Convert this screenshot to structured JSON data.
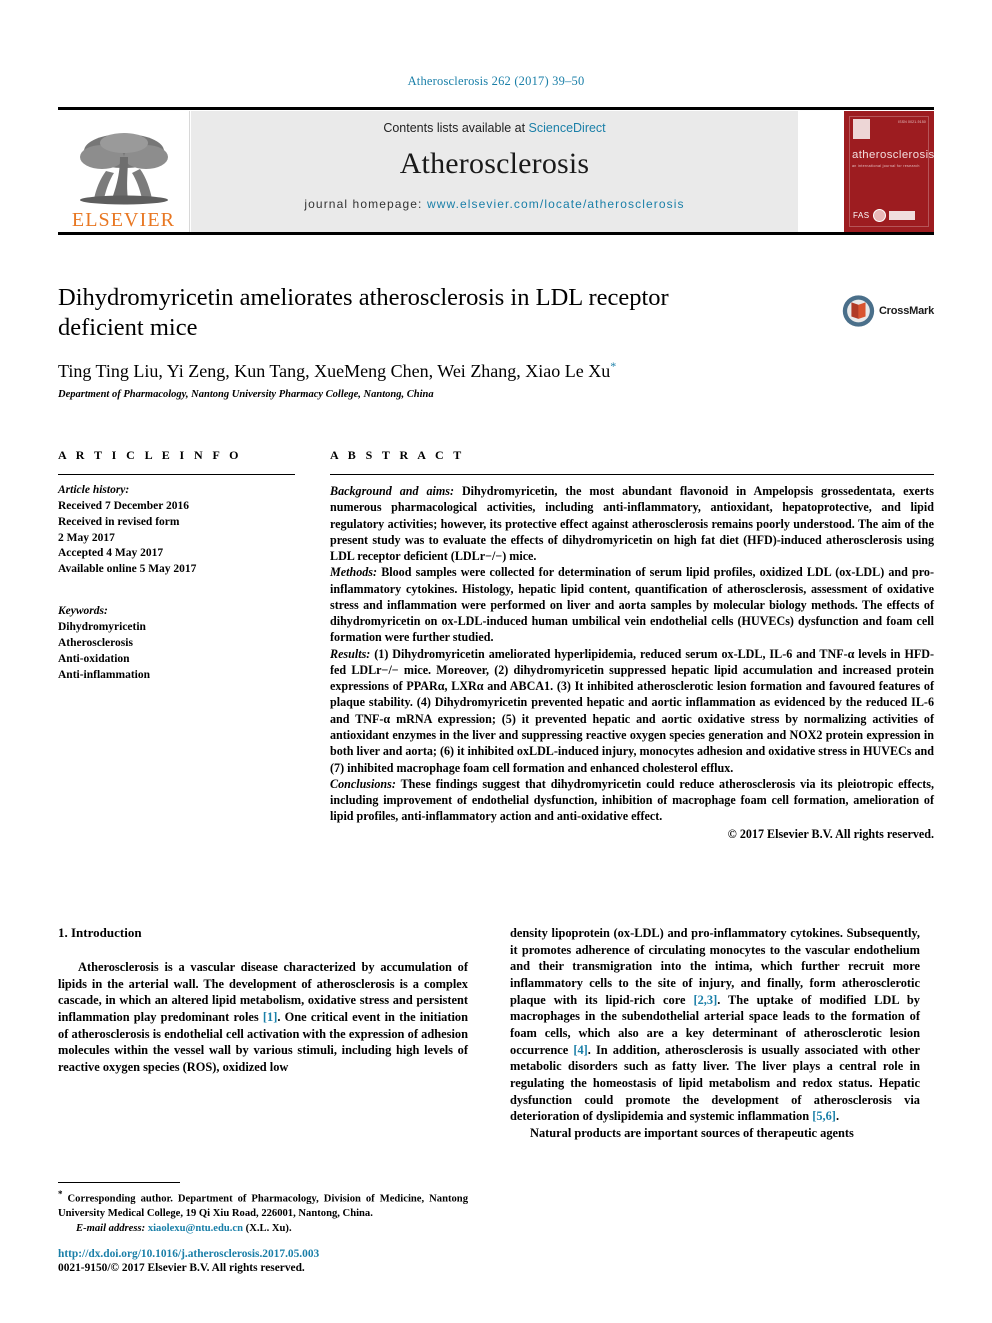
{
  "running_head": "Atherosclerosis 262 (2017) 39–50",
  "masthead": {
    "publisher_logo_text": "ELSEVIER",
    "contents_prefix": "Contents lists available at ",
    "contents_link": "ScienceDirect",
    "journal_name": "Atherosclerosis",
    "homepage_prefix": "journal homepage: ",
    "homepage_url": "www.elsevier.com/locate/atherosclerosis",
    "cover": {
      "title": "atherosclerosis",
      "subtitle": "an international journal for research",
      "corner_text": "ISSN 0021-9150",
      "society_text": "FAS"
    },
    "accent_color": "#1a7fa8",
    "cover_color": "#9d1c20",
    "elsevier_orange": "#E87722"
  },
  "article": {
    "title": "Dihydromyricetin ameliorates atherosclerosis in LDL receptor deficient mice",
    "authors": "Ting Ting Liu, Yi Zeng, Kun Tang, XueMeng Chen, Wei Zhang, Xiao Le Xu",
    "corresponding_marker": "*",
    "affiliation": "Department of Pharmacology, Nantong University Pharmacy College, Nantong, China",
    "crossmark_label": "CrossMark"
  },
  "article_info": {
    "heading": "A R T I C L E   I N F O",
    "history_label": "Article history:",
    "history_lines": [
      "Received 7 December 2016",
      "Received in revised form",
      "2 May 2017",
      "Accepted 4 May 2017",
      "Available online 5 May 2017"
    ],
    "keywords_label": "Keywords:",
    "keywords": [
      "Dihydromyricetin",
      "Atherosclerosis",
      "Anti-oxidation",
      "Anti-inflammation"
    ]
  },
  "abstract": {
    "heading": "A B S T R A C T",
    "background_label": "Background and aims:",
    "background_text": " Dihydromyricetin, the most abundant flavonoid in Ampelopsis grossedentata, exerts numerous pharmacological activities, including anti-inflammatory, antioxidant, hepatoprotective, and lipid regulatory activities; however, its protective effect against atherosclerosis remains poorly understood. The aim of the present study was to evaluate the effects of dihydromyricetin on high fat diet (HFD)-induced atherosclerosis using LDL receptor deficient (LDLr−/−) mice.",
    "methods_label": "Methods:",
    "methods_text": " Blood samples were collected for determination of serum lipid profiles, oxidized LDL (ox-LDL) and pro-inflammatory cytokines. Histology, hepatic lipid content, quantification of atherosclerosis, assessment of oxidative stress and inflammation were performed on liver and aorta samples by molecular biology methods. The effects of dihydromyricetin on ox-LDL-induced human umbilical vein endothelial cells (HUVECs) dysfunction and foam cell formation were further studied.",
    "results_label": "Results:",
    "results_text": " (1) Dihydromyricetin ameliorated hyperlipidemia, reduced serum ox-LDL, IL-6 and TNF-α levels in HFD-fed LDLr−/− mice. Moreover, (2) dihydromyricetin suppressed hepatic lipid accumulation and increased protein expressions of PPARα, LXRα and ABCA1. (3) It inhibited atherosclerotic lesion formation and favoured features of plaque stability. (4) Dihydromyricetin prevented hepatic and aortic inflammation as evidenced by the reduced IL-6 and TNF-α mRNA expression; (5) it prevented hepatic and aortic oxidative stress by normalizing activities of antioxidant enzymes in the liver and suppressing reactive oxygen species generation and NOX2 protein expression in both liver and aorta; (6) it inhibited oxLDL-induced injury, monocytes adhesion and oxidative stress in HUVECs and (7) inhibited macrophage foam cell formation and enhanced cholesterol efflux.",
    "conclusions_label": "Conclusions:",
    "conclusions_text": " These findings suggest that dihydromyricetin could reduce atherosclerosis via its pleiotropic effects, including improvement of endothelial dysfunction, inhibition of macrophage foam cell formation, amelioration of lipid profiles, anti-inflammatory action and anti-oxidative effect.",
    "copyright": "© 2017 Elsevier B.V. All rights reserved."
  },
  "introduction": {
    "heading": "1.  Introduction",
    "left_paragraph_1": "Atherosclerosis is a vascular disease characterized by accumulation of lipids in the arterial wall. The development of atherosclerosis is a complex cascade, in which an altered lipid metabolism, oxidative stress and persistent inflammation play predominant roles ",
    "left_ref_1": "[1]",
    "left_paragraph_1b": ". One critical event in the initiation of atherosclerosis is endothelial cell activation with the expression of adhesion molecules within the vessel wall by various stimuli, including high levels of reactive oxygen species (ROS), oxidized low",
    "right_paragraph_1a": "density lipoprotein (ox-LDL) and pro-inflammatory cytokines. Subsequently, it promotes adherence of circulating monocytes to the vascular endothelium and their transmigration into the intima, which further recruit more inflammatory cells to the site of injury, and finally, form atherosclerotic plaque with its lipid-rich core ",
    "right_ref_1": "[2,3]",
    "right_paragraph_1b": ". The uptake of modified LDL by macrophages in the subendothelial arterial space leads to the formation of foam cells, which also are a key determinant of atherosclerotic lesion occurrence ",
    "right_ref_2": "[4]",
    "right_paragraph_1c": ". In addition, atherosclerosis is usually associated with other metabolic disorders such as fatty liver. The liver plays a central role in regulating the homeostasis of lipid metabolism and redox status. Hepatic dysfunction could promote the development of atherosclerosis via deterioration of dyslipidemia and systemic inflammation ",
    "right_ref_3": "[5,6]",
    "right_paragraph_1d": ".",
    "right_paragraph_2": "Natural products are important sources of therapeutic agents"
  },
  "footnotes": {
    "corresponding_marker": "*",
    "corresponding_text": " Corresponding author. Department of Pharmacology, Division of Medicine, Nantong University Medical College, 19 Qi Xiu Road, 226001, Nantong, China.",
    "email_label": "E-mail address:",
    "email_address": "xiaolexu@ntu.edu.cn",
    "email_suffix": " (X.L. Xu)."
  },
  "doi": {
    "url": "http://dx.doi.org/10.1016/j.atherosclerosis.2017.05.003",
    "issn_line": "0021-9150/© 2017 Elsevier B.V. All rights reserved."
  }
}
